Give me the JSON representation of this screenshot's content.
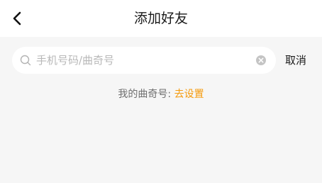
{
  "header": {
    "title": "添加好友",
    "back_icon": "chevron-left-icon"
  },
  "search": {
    "placeholder": "手机号码/曲奇号",
    "value": "",
    "search_icon": "search-icon",
    "clear_icon": "clear-circle-icon",
    "cancel_label": "取消"
  },
  "my_id": {
    "label": "我的曲奇号: ",
    "action_label": "去设置"
  },
  "colors": {
    "page_background": "#f6f6f6",
    "header_background": "#ffffff",
    "accent": "#f59a0c",
    "secondary_text": "#6f6f6f"
  }
}
